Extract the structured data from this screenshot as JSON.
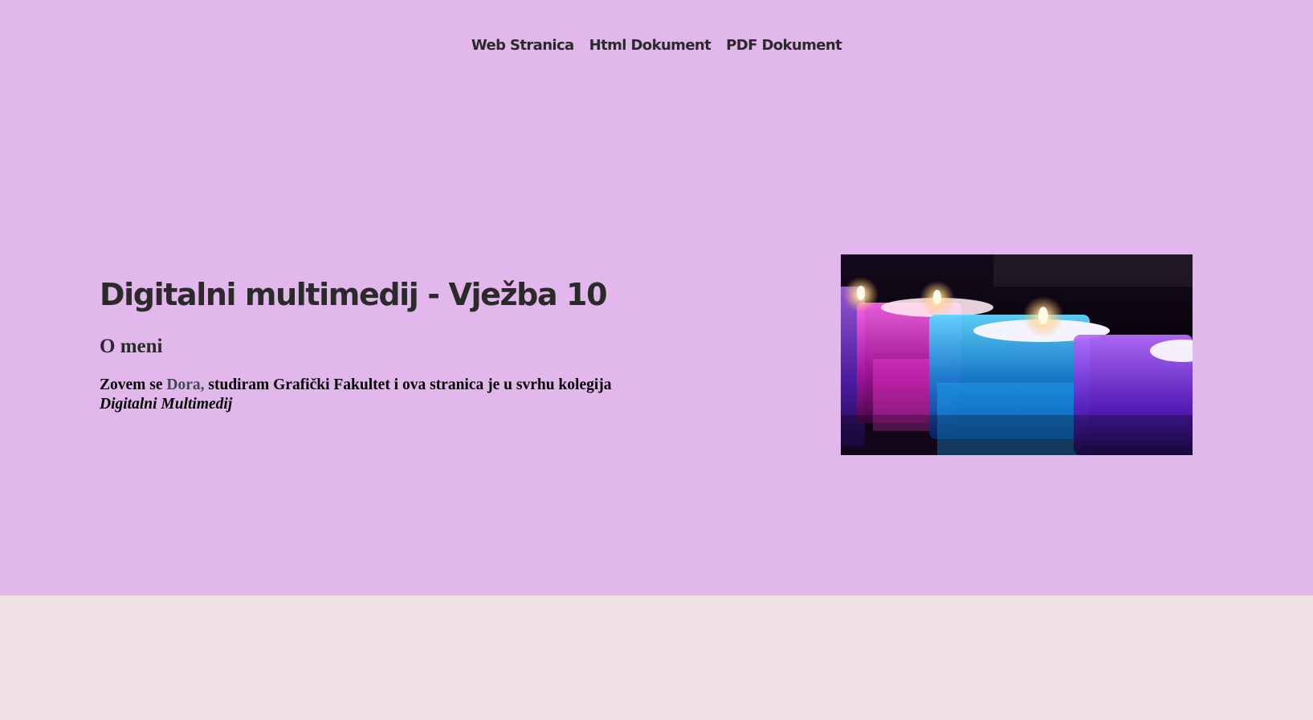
{
  "nav": {
    "items": [
      {
        "label": "Web Stranica"
      },
      {
        "label": "Html Dokument"
      },
      {
        "label": "PDF Dokument"
      }
    ]
  },
  "hero": {
    "title": "Digitalni multimedij - Vježba 10",
    "subtitle": "O meni",
    "intro": {
      "prefix": "Zovem se ",
      "name": "Dora,",
      "middle": " studiram Grafički Fakultet i ova stranica je u svrhu kolegija",
      "course": "Digitalni Multimedij"
    },
    "photo_icon": "candles-photo"
  },
  "colors": {
    "hero_background": "#e2b7eb",
    "page_background": "#f0e1e4",
    "text": "#2a2a2a",
    "name_accent": "#3e4a55"
  }
}
